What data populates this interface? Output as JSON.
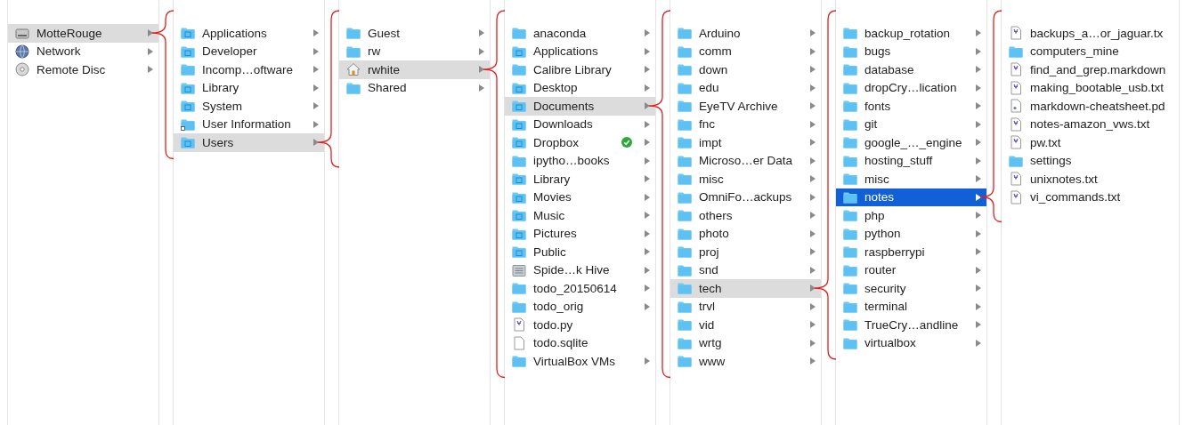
{
  "columns": [
    {
      "focused": false,
      "items": [
        {
          "name": "MotteRouge",
          "kind": "drive",
          "selected": true
        },
        {
          "name": "Network",
          "kind": "network",
          "selected": false
        },
        {
          "name": "Remote Disc",
          "kind": "disc",
          "selected": false
        }
      ]
    },
    {
      "focused": false,
      "items": [
        {
          "name": "Applications",
          "kind": "special-folder",
          "selected": false
        },
        {
          "name": "Developer",
          "kind": "special-folder",
          "selected": false
        },
        {
          "name": "Incomp…oftware",
          "kind": "folder",
          "selected": false
        },
        {
          "name": "Library",
          "kind": "special-folder",
          "selected": false
        },
        {
          "name": "System",
          "kind": "special-folder",
          "selected": false
        },
        {
          "name": "User Information",
          "kind": "alias-folder",
          "selected": false
        },
        {
          "name": "Users",
          "kind": "special-folder",
          "selected": true
        }
      ]
    },
    {
      "focused": false,
      "items": [
        {
          "name": "Guest",
          "kind": "folder",
          "selected": false
        },
        {
          "name": "rw",
          "kind": "folder",
          "selected": false
        },
        {
          "name": "rwhite",
          "kind": "home",
          "selected": true
        },
        {
          "name": "Shared",
          "kind": "folder",
          "selected": false
        }
      ]
    },
    {
      "focused": false,
      "items": [
        {
          "name": "anaconda",
          "kind": "folder",
          "selected": false
        },
        {
          "name": "Applications",
          "kind": "special-folder",
          "selected": false
        },
        {
          "name": "Calibre Library",
          "kind": "folder",
          "selected": false
        },
        {
          "name": "Desktop",
          "kind": "special-folder",
          "selected": false
        },
        {
          "name": "Documents",
          "kind": "special-folder",
          "selected": true
        },
        {
          "name": "Downloads",
          "kind": "special-folder",
          "selected": false
        },
        {
          "name": "Dropbox",
          "kind": "special-folder",
          "selected": false,
          "synced": true
        },
        {
          "name": "ipytho…books",
          "kind": "folder",
          "selected": false
        },
        {
          "name": "Library",
          "kind": "special-folder",
          "selected": false
        },
        {
          "name": "Movies",
          "kind": "special-folder",
          "selected": false
        },
        {
          "name": "Music",
          "kind": "special-folder",
          "selected": false
        },
        {
          "name": "Pictures",
          "kind": "special-folder",
          "selected": false
        },
        {
          "name": "Public",
          "kind": "special-folder",
          "selected": false
        },
        {
          "name": "Spide…k Hive",
          "kind": "package",
          "selected": false
        },
        {
          "name": "todo_20150614",
          "kind": "folder",
          "selected": false
        },
        {
          "name": "todo_orig",
          "kind": "folder",
          "selected": false
        },
        {
          "name": "todo.py",
          "kind": "text-file",
          "selected": false
        },
        {
          "name": "todo.sqlite",
          "kind": "blank-file",
          "selected": false
        },
        {
          "name": "VirtualBox VMs",
          "kind": "folder",
          "selected": false
        }
      ]
    },
    {
      "focused": false,
      "items": [
        {
          "name": "Arduino",
          "kind": "folder",
          "selected": false
        },
        {
          "name": "comm",
          "kind": "folder",
          "selected": false
        },
        {
          "name": "down",
          "kind": "folder",
          "selected": false
        },
        {
          "name": "edu",
          "kind": "folder",
          "selected": false
        },
        {
          "name": "EyeTV Archive",
          "kind": "folder",
          "selected": false
        },
        {
          "name": "fnc",
          "kind": "folder",
          "selected": false
        },
        {
          "name": "impt",
          "kind": "folder",
          "selected": false
        },
        {
          "name": "Microso…er Data",
          "kind": "folder",
          "selected": false
        },
        {
          "name": "misc",
          "kind": "folder",
          "selected": false
        },
        {
          "name": "OmniFo…ackups",
          "kind": "folder",
          "selected": false
        },
        {
          "name": "others",
          "kind": "folder",
          "selected": false
        },
        {
          "name": "photo",
          "kind": "folder",
          "selected": false
        },
        {
          "name": "proj",
          "kind": "folder",
          "selected": false
        },
        {
          "name": "snd",
          "kind": "folder",
          "selected": false
        },
        {
          "name": "tech",
          "kind": "folder",
          "selected": true
        },
        {
          "name": "trvl",
          "kind": "folder",
          "selected": false
        },
        {
          "name": "vid",
          "kind": "folder",
          "selected": false
        },
        {
          "name": "wrtg",
          "kind": "folder",
          "selected": false
        },
        {
          "name": "www",
          "kind": "folder",
          "selected": false
        }
      ]
    },
    {
      "focused": true,
      "items": [
        {
          "name": "backup_rotation",
          "kind": "folder",
          "selected": false
        },
        {
          "name": "bugs",
          "kind": "folder",
          "selected": false
        },
        {
          "name": "database",
          "kind": "folder",
          "selected": false
        },
        {
          "name": "dropCry…lication",
          "kind": "folder",
          "selected": false
        },
        {
          "name": "fonts",
          "kind": "folder",
          "selected": false
        },
        {
          "name": "git",
          "kind": "folder",
          "selected": false
        },
        {
          "name": "google_…_engine",
          "kind": "folder",
          "selected": false
        },
        {
          "name": "hosting_stuff",
          "kind": "folder",
          "selected": false
        },
        {
          "name": "misc",
          "kind": "folder",
          "selected": false
        },
        {
          "name": "notes",
          "kind": "folder",
          "selected": true
        },
        {
          "name": "php",
          "kind": "folder",
          "selected": false
        },
        {
          "name": "python",
          "kind": "folder",
          "selected": false
        },
        {
          "name": "raspberrypi",
          "kind": "folder",
          "selected": false
        },
        {
          "name": "router",
          "kind": "folder",
          "selected": false
        },
        {
          "name": "security",
          "kind": "folder",
          "selected": false
        },
        {
          "name": "terminal",
          "kind": "folder",
          "selected": false
        },
        {
          "name": "TrueCry…andline",
          "kind": "folder",
          "selected": false
        },
        {
          "name": "virtualbox",
          "kind": "folder",
          "selected": false
        }
      ]
    },
    {
      "items": [
        {
          "name": "backups_a…or_jaguar.tx",
          "kind": "text-file",
          "selected": false
        },
        {
          "name": "computers_mine",
          "kind": "folder",
          "selected": false,
          "arrow": false
        },
        {
          "name": "find_and_grep.markdown",
          "kind": "text-file",
          "selected": false
        },
        {
          "name": "making_bootable_usb.txt",
          "kind": "text-file",
          "selected": false
        },
        {
          "name": "markdown-cheatsheet.pd",
          "kind": "pdf-file",
          "selected": false
        },
        {
          "name": "notes-amazon_vws.txt",
          "kind": "text-file",
          "selected": false
        },
        {
          "name": "pw.txt",
          "kind": "text-file",
          "selected": false
        },
        {
          "name": "settings",
          "kind": "folder",
          "selected": false,
          "arrow": false
        },
        {
          "name": "unixnotes.txt",
          "kind": "text-file",
          "selected": false
        },
        {
          "name": "vi_commands.txt",
          "kind": "text-file",
          "selected": false
        }
      ]
    }
  ]
}
